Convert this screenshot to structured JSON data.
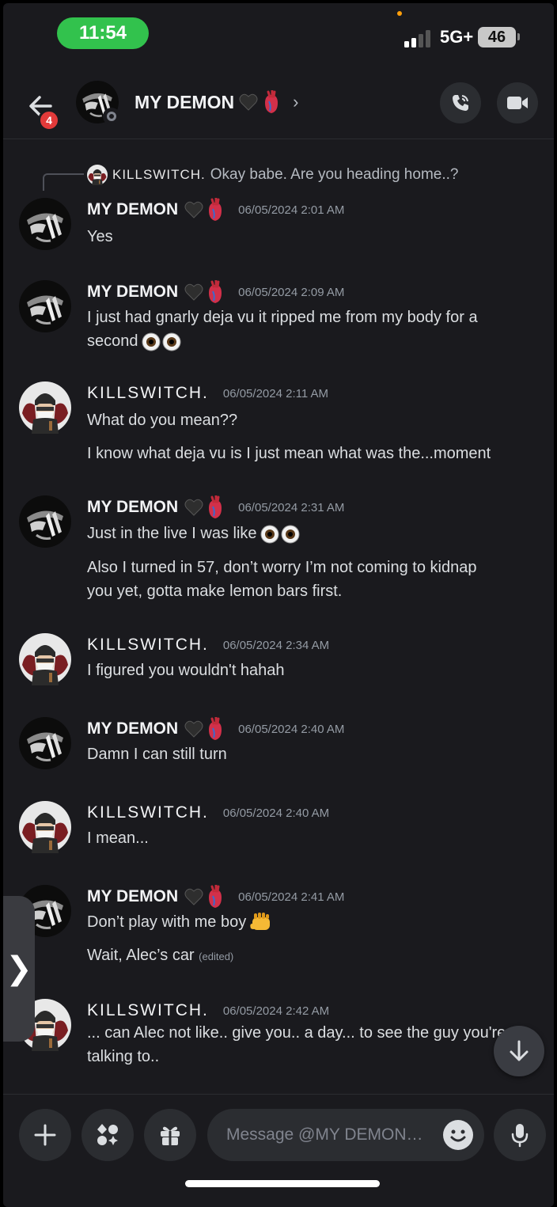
{
  "status_bar": {
    "time": "11:54",
    "network": "5G+",
    "battery": "46"
  },
  "header": {
    "unread_count": "4",
    "title": "MY DEMON"
  },
  "reply": {
    "name": "KILLSWITCH.",
    "text": "Okay babe. Are you heading home..?"
  },
  "messages": [
    {
      "user": "MY DEMON",
      "timestamp": "06/05/2024 2:01 AM",
      "lines": [
        "Yes"
      ]
    },
    {
      "user": "MY DEMON",
      "timestamp": "06/05/2024 2:09 AM",
      "lines": [
        "I just had gnarly deja vu it ripped me from my body for a",
        "second"
      ]
    },
    {
      "user": "KILLSWITCH.",
      "timestamp": "06/05/2024 2:11 AM",
      "lines": [
        "What do you mean??",
        "I know what deja vu is I just mean what was the...moment"
      ]
    },
    {
      "user": "MY DEMON",
      "timestamp": "06/05/2024 2:31 AM",
      "lines": [
        "Just in the live I was like",
        "Also I turned in 57, don’t worry I’m not coming to kidnap",
        "you yet, gotta make lemon bars first."
      ]
    },
    {
      "user": "KILLSWITCH.",
      "timestamp": "06/05/2024 2:34 AM",
      "lines": [
        "I figured you wouldn't hahah"
      ]
    },
    {
      "user": "MY DEMON",
      "timestamp": "06/05/2024 2:40 AM",
      "lines": [
        "Damn I can still turn"
      ]
    },
    {
      "user": "KILLSWITCH.",
      "timestamp": "06/05/2024 2:40 AM",
      "lines": [
        "I mean..."
      ]
    },
    {
      "user": "MY DEMON",
      "timestamp": "06/05/2024 2:41 AM",
      "lines": [
        "Don’t play with me boy",
        "Wait, Alec’s car"
      ],
      "edited_label": "(edited)"
    },
    {
      "user": "KILLSWITCH.",
      "timestamp": "06/05/2024 2:42 AM",
      "lines": [
        "... can Alec not like.. give you.. a day... to see the guy you're",
        "talking to.."
      ]
    }
  ],
  "composer": {
    "placeholder": "Message @MY DEMON…"
  },
  "icons": [
    "back-arrow-icon",
    "phone-call-icon",
    "video-camera-icon",
    "plus-icon",
    "apps-icon",
    "gift-icon",
    "emoji-icon",
    "microphone-icon",
    "arrow-down-icon",
    "chevron-right-icon",
    "black-heart-icon",
    "anatomical-heart-icon",
    "eyes-icon",
    "fist-icon"
  ],
  "colors": {
    "background": "#1a1a1e",
    "status_pill": "#32c24d",
    "badge": "#e23a3a",
    "timestamp": "#949ba4"
  }
}
